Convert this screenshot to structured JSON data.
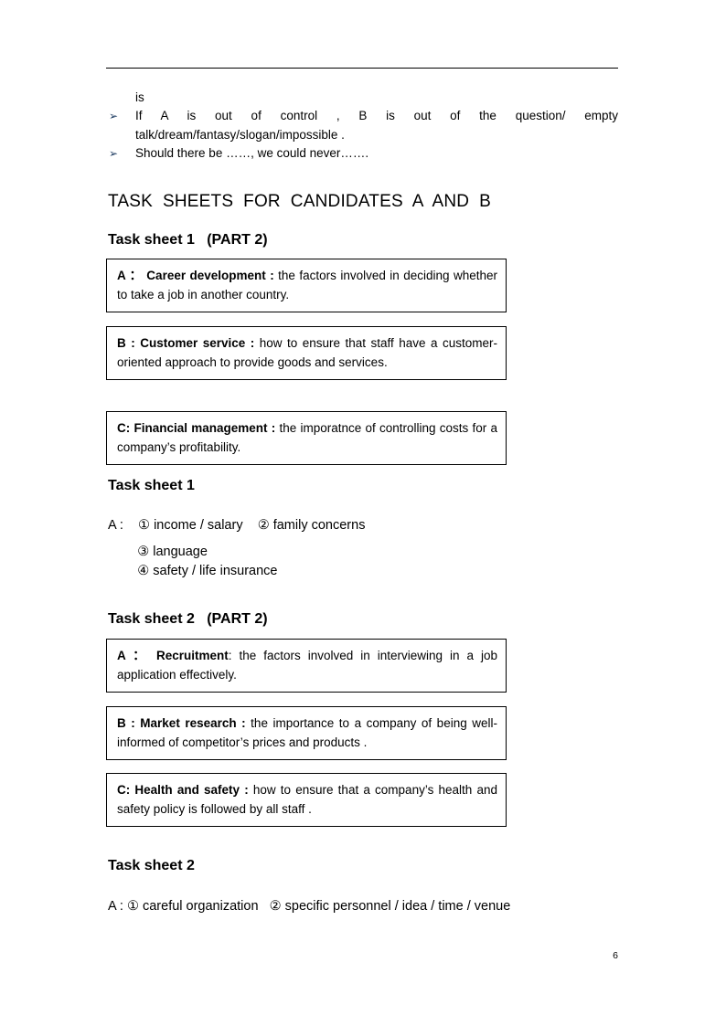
{
  "document": {
    "page_number": "6",
    "bullet_marker": "➢",
    "bullet_color": "#17365d"
  },
  "intro": {
    "orphan_line": "is",
    "bullets": [
      "If A is out of control , B is out of the question/ empty talk/dream/fantasy/slogan/impossible .",
      "Should there be ……, we could never……."
    ]
  },
  "main_title": "TASK  SHEETS  FOR  CANDIDATES  A  AND  B",
  "sections": [
    {
      "heading": "Task sheet 1   (PART 2)",
      "boxes": [
        {
          "label": "A ： Career development :",
          "body": " the factors involved in deciding whether to take a job in another country."
        },
        {
          "label": "B : Customer service :",
          "body": " how to ensure that staff have a customer-oriented approach to provide goods and services."
        },
        {
          "label": "C: Financial management :",
          "body": " the imporatnce of controlling costs for a company’s profitability."
        }
      ]
    },
    {
      "heading": "Task sheet 2   (PART 2)",
      "boxes": [
        {
          "label": "A ： Recruitment",
          "body": ": the factors involved in interviewing in a job application effectively."
        },
        {
          "label": "B : Market research :",
          "body": " the importance to a company of being well-informed of competitor’s prices and products ."
        },
        {
          "label": "C: Health and safety :",
          "body": " how to ensure that a company’s health and safety policy is followed by all staff ."
        }
      ]
    }
  ],
  "answers": [
    {
      "heading": "Task sheet 1",
      "lines": [
        "A :    ① income / salary    ② family concerns",
        "        ③ language",
        "        ④ safety / life insurance"
      ]
    },
    {
      "heading": "Task sheet 2",
      "lines": [
        "A : ① careful organization   ② specific personnel / idea / time / venue"
      ]
    }
  ]
}
